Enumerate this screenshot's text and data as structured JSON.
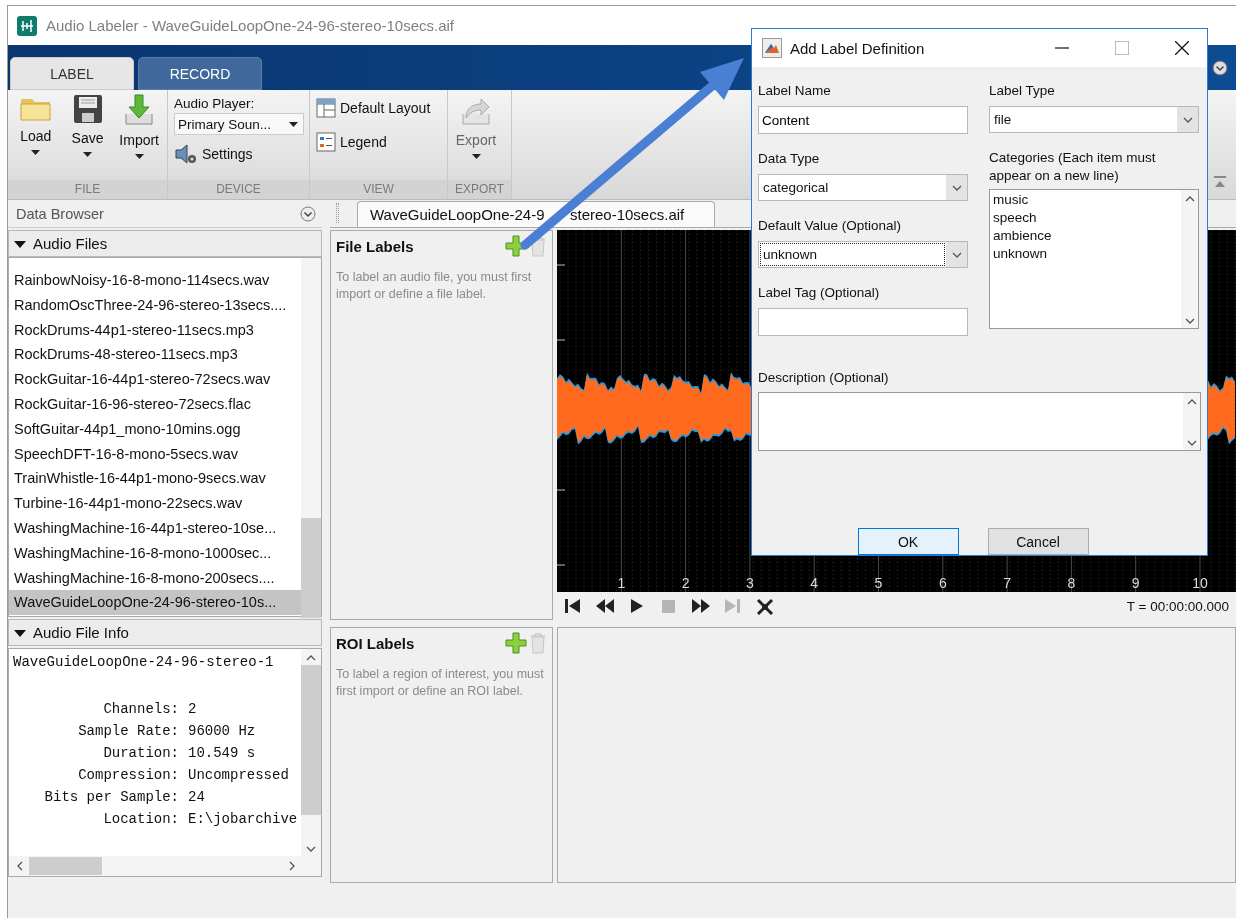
{
  "window": {
    "title": "Audio Labeler - WaveGuideLoopOne-24-96-stereo-10secs.aif"
  },
  "ribbon_tabs": [
    {
      "label": "LABEL",
      "selected": true
    },
    {
      "label": "RECORD",
      "selected": false
    }
  ],
  "ribbon": {
    "file_group": {
      "title": "FILE",
      "load_button": "Load",
      "save_button": "Save",
      "import_button": "Import"
    },
    "device_group": {
      "title": "DEVICE",
      "player_label": "Audio Player:",
      "player_select": "Primary Soun...",
      "settings_button": "Settings"
    },
    "view_group": {
      "title": "VIEW",
      "default_layout_button": "Default Layout",
      "legend_button": "Legend"
    },
    "export_group": {
      "title": "EXPORT",
      "export_button": {
        "label": "Export",
        "disabled": true
      }
    }
  },
  "data_browser": {
    "title": "Data Browser",
    "audio_files": {
      "title": "Audio Files",
      "expanded": true,
      "files": [
        {
          "name": "RainbowNoisy-16-8-mono-114secs.wav",
          "selected": false
        },
        {
          "name": "RandomOscThree-24-96-stereo-13secs....",
          "selected": false
        },
        {
          "name": "RockDrums-44p1-stereo-11secs.mp3",
          "selected": false
        },
        {
          "name": "RockDrums-48-stereo-11secs.mp3",
          "selected": false
        },
        {
          "name": "RockGuitar-16-44p1-stereo-72secs.wav",
          "selected": false
        },
        {
          "name": "RockGuitar-16-96-stereo-72secs.flac",
          "selected": false
        },
        {
          "name": "SoftGuitar-44p1_mono-10mins.ogg",
          "selected": false
        },
        {
          "name": "SpeechDFT-16-8-mono-5secs.wav",
          "selected": false
        },
        {
          "name": "TrainWhistle-16-44p1-mono-9secs.wav",
          "selected": false
        },
        {
          "name": "Turbine-16-44p1-mono-22secs.wav",
          "selected": false
        },
        {
          "name": "WashingMachine-16-44p1-stereo-10se...",
          "selected": false
        },
        {
          "name": "WashingMachine-16-8-mono-1000sec...",
          "selected": false
        },
        {
          "name": "WashingMachine-16-8-mono-200secs....",
          "selected": false
        },
        {
          "name": "WaveGuideLoopOne-24-96-stereo-10s...",
          "selected": true
        }
      ]
    },
    "file_info": {
      "title": "Audio File Info",
      "expanded": true,
      "file_name": "WaveGuideLoopOne-24-96-stereo-1",
      "fields": [
        {
          "label": "Channels:",
          "value": "2"
        },
        {
          "label": "Sample Rate:",
          "value": "96000 Hz"
        },
        {
          "label": "Duration:",
          "value": "10.549 s"
        },
        {
          "label": "Compression:",
          "value": "Uncompressed"
        },
        {
          "label": "Bits per Sample:",
          "value": "24"
        },
        {
          "label": "Location:",
          "value": "E:\\jobarchive"
        }
      ]
    }
  },
  "file_labels": {
    "title": "File Labels",
    "hint": "To label an audio file, you must first import or define a file label.",
    "delete_disabled": true
  },
  "roi_labels": {
    "title": "ROI Labels",
    "hint": "To label a region of interest, you must first import or define an ROI label.",
    "delete_disabled": true
  },
  "signal_view": {
    "tab_parts": [
      "WaveGuideLoopOne-24-9",
      "stereo-10secs.aif"
    ],
    "time_ticks": [
      "1",
      "2",
      "3",
      "4",
      "5",
      "6",
      "7",
      "8",
      "9",
      "10"
    ],
    "transport": [
      {
        "kind": "first",
        "disabled": false
      },
      {
        "kind": "rewind",
        "disabled": false
      },
      {
        "kind": "play",
        "disabled": false
      },
      {
        "kind": "stop",
        "disabled": true
      },
      {
        "kind": "forward",
        "disabled": false
      },
      {
        "kind": "last",
        "disabled": true
      },
      {
        "kind": "tools",
        "disabled": false
      }
    ],
    "time_readout": "T = 00:00:00.000"
  },
  "dialog": {
    "title": "Add Label Definition",
    "label_name": {
      "label": "Label Name",
      "value": "Content"
    },
    "data_type": {
      "label": "Data Type",
      "value": "categorical"
    },
    "default_value": {
      "label": "Default Value (Optional)",
      "value": "unknown",
      "focused": true
    },
    "label_tag": {
      "label": "Label Tag (Optional)"
    },
    "label_type": {
      "label": "Label Type",
      "value": "file"
    },
    "categories": {
      "label": "Categories (Each item must appear on a new line)",
      "items": [
        "music",
        "speech",
        "ambience",
        "unknown"
      ]
    },
    "description": {
      "label": "Description (Optional)"
    },
    "buttons": [
      {
        "label": "OK",
        "default": true
      },
      {
        "label": "Cancel",
        "default": false
      }
    ]
  }
}
